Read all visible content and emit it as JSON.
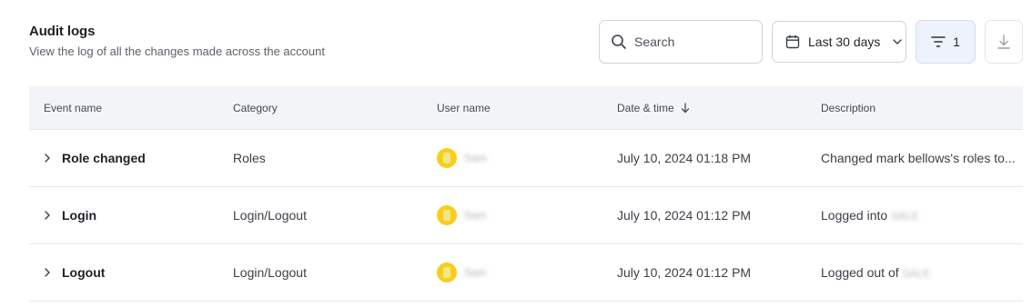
{
  "header": {
    "title": "Audit logs",
    "subtitle": "View the log of all the changes made across the account"
  },
  "toolbar": {
    "search_placeholder": "Search",
    "date_range_label": "Last 30 days",
    "filter_count": "1"
  },
  "table": {
    "columns": [
      "Event name",
      "Category",
      "User name",
      "Date & time",
      "Description"
    ],
    "rows": [
      {
        "event": "Role changed",
        "category": "Roles",
        "user": "Sam",
        "datetime": "July 10, 2024 01:18 PM",
        "description": "Changed mark bellows's roles to...",
        "description_redacted": ""
      },
      {
        "event": "Login",
        "category": "Login/Logout",
        "user": "Sam",
        "datetime": "July 10, 2024 01:12 PM",
        "description": "Logged into",
        "description_redacted": "SALE"
      },
      {
        "event": "Logout",
        "category": "Login/Logout",
        "user": "Sam",
        "datetime": "July 10, 2024 01:12 PM",
        "description": "Logged out of",
        "description_redacted": "SALE"
      }
    ]
  },
  "icons": {
    "search": "search-icon",
    "calendar": "calendar-icon",
    "chevron_down": "chevron-down-icon",
    "filter": "filter-icon",
    "download": "download-icon",
    "sort": "arrow-down-icon",
    "expand": "chevron-right-icon"
  },
  "colors": {
    "avatar": "#f7cf1a",
    "filter_active_bg": "#eef2fd",
    "header_bg": "#f2f4f7"
  }
}
